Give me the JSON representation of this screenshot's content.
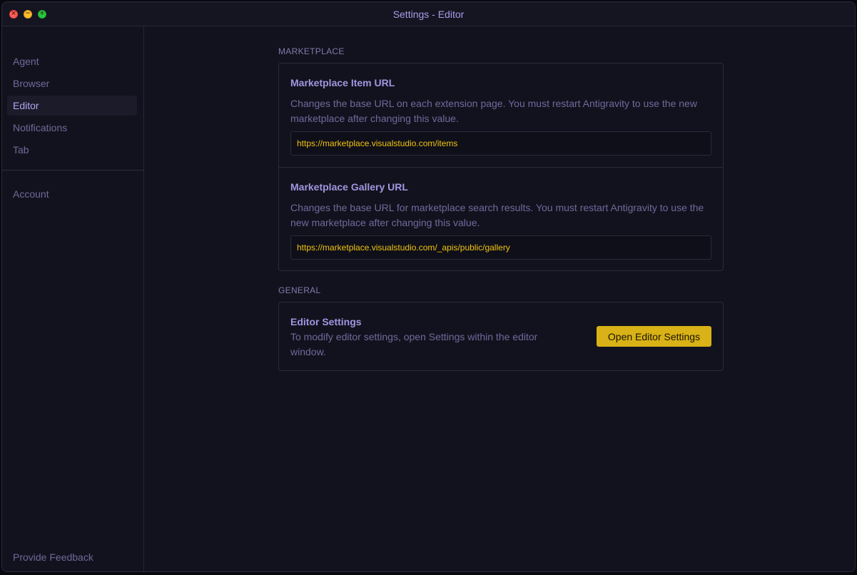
{
  "window": {
    "title": "Settings - Editor"
  },
  "sidebar": {
    "items": [
      {
        "label": "Agent"
      },
      {
        "label": "Browser"
      },
      {
        "label": "Editor"
      },
      {
        "label": "Notifications"
      },
      {
        "label": "Tab"
      }
    ],
    "account_label": "Account",
    "feedback_label": "Provide Feedback",
    "active": "Editor"
  },
  "marketplace": {
    "section_label": "MARKETPLACE",
    "item_url": {
      "title": "Marketplace Item URL",
      "description": "Changes the base URL on each extension page. You must restart Antigravity to use the new marketplace after changing this value.",
      "value": "https://marketplace.visualstudio.com/items"
    },
    "gallery_url": {
      "title": "Marketplace Gallery URL",
      "description": "Changes the base URL for marketplace search results. You must restart Antigravity to use the new marketplace after changing this value.",
      "value": "https://marketplace.visualstudio.com/_apis/public/gallery"
    }
  },
  "general": {
    "section_label": "GENERAL",
    "editor_settings": {
      "title": "Editor Settings",
      "description": "To modify editor settings, open Settings within the editor window.",
      "button_label": "Open Editor Settings"
    }
  },
  "colors": {
    "accent": "#d8b216",
    "url_text": "#f1c40f",
    "heading": "#a196e0",
    "muted": "#6e6a9c",
    "background": "#12121e"
  }
}
